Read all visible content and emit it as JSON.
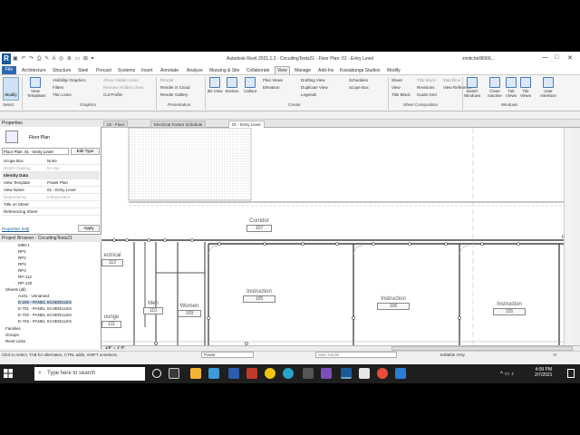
{
  "window": {
    "title": "Autodesk Revit 2021.1.2 - CircuitingTests21 - Floor Plan: 01 - Entry Level",
    "user": "zimtichell9066..."
  },
  "menu_tabs": [
    "File",
    "Architecture",
    "Structure",
    "Steel",
    "Precast",
    "Systems",
    "Insert",
    "Annotate",
    "Analyze",
    "Massing & Site",
    "Collaborate",
    "View",
    "Manage",
    "Add-Ins",
    "Kowabunga Studios",
    "Modify"
  ],
  "ribbon": {
    "modify_label": "Modify",
    "view_templates": "View Templates",
    "graphics_items": [
      "Visibility/ Graphics",
      "Filters",
      "Thin Lines",
      "Show Hidden Lines",
      "Remove Hidden Lines",
      "Cut Profile"
    ],
    "presentation_items": [
      "Render",
      "Render in Cloud",
      "Render Gallery"
    ],
    "create_big": [
      "3D View",
      "Section",
      "Callout"
    ],
    "create_items": [
      "Plan Views",
      "Elevation",
      "Drafting View",
      "Duplicate View",
      "Legends",
      "Schedules",
      "Scope Box"
    ],
    "sheet_items": [
      "Sheet",
      "View",
      "Title Block",
      "Revisions",
      "Guide Grid",
      "Matchline",
      "View Reference"
    ],
    "windows_items": [
      "Switch Windows",
      "Close Inactive",
      "Tab Views",
      "Tile Views",
      "User Interface"
    ],
    "panels": [
      "Select",
      "Graphics",
      "Presentation",
      "Create",
      "Sheet Composition",
      "Windows"
    ]
  },
  "view_tabs": [
    "02 - Floor",
    "Electrical Fixture Schedule",
    "01 - Entry Level"
  ],
  "properties": {
    "title": "Properties",
    "type_name": "Floor Plan",
    "selector": "Floor Plan: 01 - Entry Level",
    "edit_type": "Edit Type",
    "rows": [
      {
        "k": "Scope Box",
        "v": "None"
      },
      {
        "k": "Depth Clipping",
        "v": "No clip"
      },
      {
        "k": "Identity Data",
        "v": ""
      },
      {
        "k": "View Template",
        "v": "Power Plan"
      },
      {
        "k": "View Name",
        "v": "01 - Entry Level"
      },
      {
        "k": "Dependency",
        "v": "Independent"
      },
      {
        "k": "Title on Sheet",
        "v": ""
      },
      {
        "k": "Referencing Sheet",
        "v": ""
      }
    ],
    "help": "Properties help",
    "apply": "Apply"
  },
  "browser": {
    "title": "Project Browser - CircuitingTests21",
    "items": [
      "M98-1",
      "RP1",
      "RP2",
      "RP3",
      "RP4",
      "RP-112",
      "RP-120",
      "Sheets (all)",
      "A101 - Unnamed",
      "E-200 - PANEL SCHEDULES",
      "E-701 - PANEL SCHEDULES",
      "E-702 - PANEL SCHEDULES",
      "E-703 - PANEL SCHEDULES",
      "Families",
      "Groups",
      "Revit Links"
    ]
  },
  "rooms": [
    {
      "name": "Corridor",
      "num": "107"
    },
    {
      "name": "Instruction",
      "num": "105"
    },
    {
      "name": "Instruction",
      "num": "106"
    },
    {
      "name": "Instruction",
      "num": "105"
    },
    {
      "name": "Men",
      "num": "110"
    },
    {
      "name": "Women",
      "num": "109"
    },
    {
      "name": "ectrical",
      "num": "112"
    },
    {
      "name": "ounge",
      "num": "111"
    }
  ],
  "view_control": {
    "scale": "1/8\" = 1'-0\""
  },
  "status": {
    "hint": "Click to select, TAB for alternates, CTRL adds, SHIFT unselects.",
    "workset": "Power",
    "model": "Main Model",
    "editable_only": "Editable Only",
    "filter_count": ":0"
  },
  "taskbar": {
    "search_placeholder": "Type here to search",
    "time": "4:09 PM",
    "date": "2/7/2021"
  },
  "colors": {
    "accent": "#2d6ab3",
    "taskbar": "#1e1e1e"
  }
}
